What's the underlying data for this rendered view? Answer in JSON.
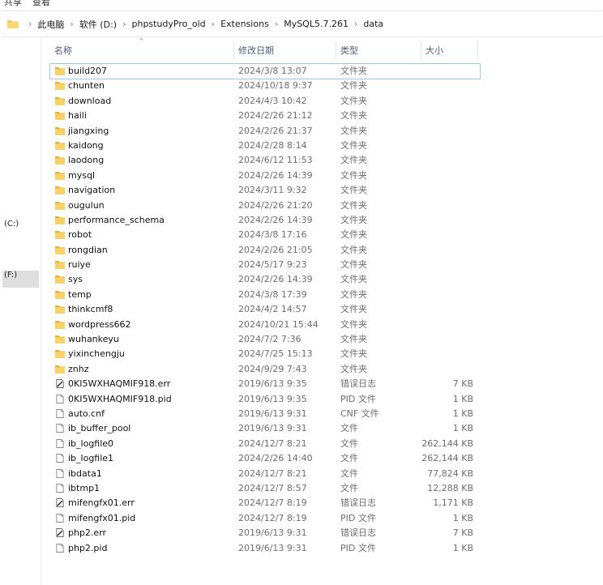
{
  "ribbon": {
    "tabs": [
      "共享",
      "查看"
    ]
  },
  "address": {
    "crumbs": [
      "此电脑",
      "软件 (D:)",
      "phpstudyPro_old",
      "Extensions",
      "MySQL5.7.261",
      "data"
    ]
  },
  "sidebar": {
    "drives": [
      "(C:)",
      "(F:)"
    ]
  },
  "columns": {
    "name": "名称",
    "date": "修改日期",
    "type": "类型",
    "size": "大小"
  },
  "files": [
    {
      "name": "build207",
      "date": "2024/3/8 13:07",
      "type": "文件夹",
      "size": "",
      "icon": "folder-icon"
    },
    {
      "name": "chunten",
      "date": "2024/10/18 9:37",
      "type": "文件夹",
      "size": "",
      "icon": "folder-icon"
    },
    {
      "name": "download",
      "date": "2024/4/3 10:42",
      "type": "文件夹",
      "size": "",
      "icon": "folder-icon"
    },
    {
      "name": "haili",
      "date": "2024/2/26 21:12",
      "type": "文件夹",
      "size": "",
      "icon": "folder-icon"
    },
    {
      "name": "jiangxing",
      "date": "2024/2/26 21:37",
      "type": "文件夹",
      "size": "",
      "icon": "folder-icon"
    },
    {
      "name": "kaidong",
      "date": "2024/2/28 8:14",
      "type": "文件夹",
      "size": "",
      "icon": "folder-icon"
    },
    {
      "name": "laodong",
      "date": "2024/6/12 11:53",
      "type": "文件夹",
      "size": "",
      "icon": "folder-icon"
    },
    {
      "name": "mysql",
      "date": "2024/2/26 14:39",
      "type": "文件夹",
      "size": "",
      "icon": "folder-icon"
    },
    {
      "name": "navigation",
      "date": "2024/3/11 9:32",
      "type": "文件夹",
      "size": "",
      "icon": "folder-icon"
    },
    {
      "name": "ougulun",
      "date": "2024/2/26 21:20",
      "type": "文件夹",
      "size": "",
      "icon": "folder-icon"
    },
    {
      "name": "performance_schema",
      "date": "2024/2/26 14:39",
      "type": "文件夹",
      "size": "",
      "icon": "folder-icon"
    },
    {
      "name": "robot",
      "date": "2024/3/8 17:16",
      "type": "文件夹",
      "size": "",
      "icon": "folder-icon"
    },
    {
      "name": "rongdian",
      "date": "2024/2/26 21:05",
      "type": "文件夹",
      "size": "",
      "icon": "folder-icon"
    },
    {
      "name": "ruiye",
      "date": "2024/5/17 9:23",
      "type": "文件夹",
      "size": "",
      "icon": "folder-icon"
    },
    {
      "name": "sys",
      "date": "2024/2/26 14:39",
      "type": "文件夹",
      "size": "",
      "icon": "folder-icon"
    },
    {
      "name": "temp",
      "date": "2024/3/8 17:39",
      "type": "文件夹",
      "size": "",
      "icon": "folder-icon"
    },
    {
      "name": "thinkcmf8",
      "date": "2024/4/2 14:57",
      "type": "文件夹",
      "size": "",
      "icon": "folder-icon"
    },
    {
      "name": "wordpress662",
      "date": "2024/10/21 15:44",
      "type": "文件夹",
      "size": "",
      "icon": "folder-icon"
    },
    {
      "name": "wuhankeyu",
      "date": "2024/7/2 7:36",
      "type": "文件夹",
      "size": "",
      "icon": "folder-icon"
    },
    {
      "name": "yixinchengju",
      "date": "2024/7/25 15:13",
      "type": "文件夹",
      "size": "",
      "icon": "folder-icon"
    },
    {
      "name": "znhz",
      "date": "2024/9/29 7:43",
      "type": "文件夹",
      "size": "",
      "icon": "folder-icon"
    },
    {
      "name": "0KI5WXHAQMIF918.err",
      "date": "2019/6/13 9:35",
      "type": "错误日志",
      "size": "7 KB",
      "icon": "error-log-icon"
    },
    {
      "name": "0KI5WXHAQMIF918.pid",
      "date": "2019/6/13 9:35",
      "type": "PID 文件",
      "size": "1 KB",
      "icon": "file-icon"
    },
    {
      "name": "auto.cnf",
      "date": "2019/6/13 9:31",
      "type": "CNF 文件",
      "size": "1 KB",
      "icon": "file-icon"
    },
    {
      "name": "ib_buffer_pool",
      "date": "2019/6/13 9:31",
      "type": "文件",
      "size": "1 KB",
      "icon": "file-icon"
    },
    {
      "name": "ib_logfile0",
      "date": "2024/12/7 8:21",
      "type": "文件",
      "size": "262,144 KB",
      "icon": "file-icon"
    },
    {
      "name": "ib_logfile1",
      "date": "2024/2/26 14:40",
      "type": "文件",
      "size": "262,144 KB",
      "icon": "file-icon"
    },
    {
      "name": "ibdata1",
      "date": "2024/12/7 8:21",
      "type": "文件",
      "size": "77,824 KB",
      "icon": "file-icon"
    },
    {
      "name": "ibtmp1",
      "date": "2024/12/7 8:57",
      "type": "文件",
      "size": "12,288 KB",
      "icon": "file-icon"
    },
    {
      "name": "mifengfx01.err",
      "date": "2024/12/7 8:19",
      "type": "错误日志",
      "size": "1,171 KB",
      "icon": "error-log-icon"
    },
    {
      "name": "mifengfx01.pid",
      "date": "2024/12/7 8:19",
      "type": "PID 文件",
      "size": "1 KB",
      "icon": "file-icon"
    },
    {
      "name": "php2.err",
      "date": "2019/6/13 9:31",
      "type": "错误日志",
      "size": "7 KB",
      "icon": "error-log-icon"
    },
    {
      "name": "php2.pid",
      "date": "2019/6/13 9:31",
      "type": "PID 文件",
      "size": "1 KB",
      "icon": "file-icon"
    }
  ],
  "colors": {
    "folder": "#f3cc5c",
    "folder_dark": "#e0b23b",
    "header_text": "#4c607a",
    "selection_border": "#9cc9f0"
  }
}
